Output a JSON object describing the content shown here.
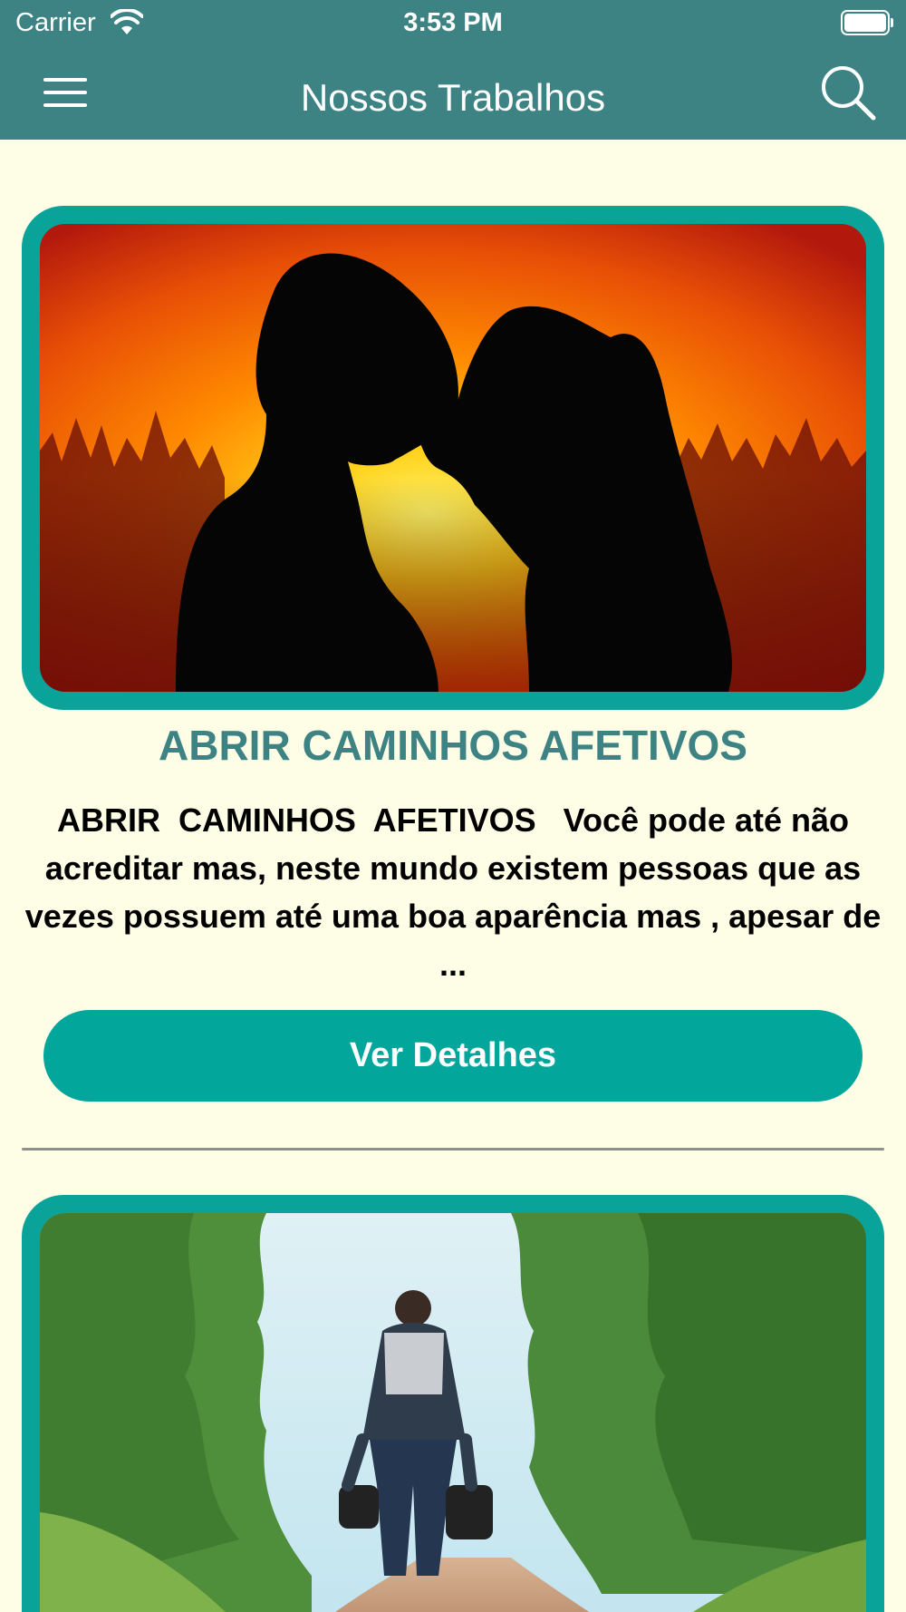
{
  "status_bar": {
    "carrier": "Carrier",
    "time": "3:53 PM"
  },
  "nav_bar": {
    "title": "Nossos Trabalhos"
  },
  "icons": {
    "menu": "hamburger-menu-icon",
    "search": "search-icon",
    "wifi": "wifi-icon",
    "battery": "battery-icon"
  },
  "colors": {
    "header": "#3d8383",
    "background": "#fefde6",
    "accent": "#0aa39a",
    "button": "#03a69a",
    "title": "#3d8383"
  },
  "cards": [
    {
      "title": "ABRIR CAMINHOS AFETIVOS",
      "description": "ABRIR  CAMINHOS  AFETIVOS   Você pode até não acreditar mas, neste mundo existem pessoas que as vezes possuem até uma boa aparência mas , apesar de ...",
      "button_label": "Ver Detalhes"
    }
  ]
}
